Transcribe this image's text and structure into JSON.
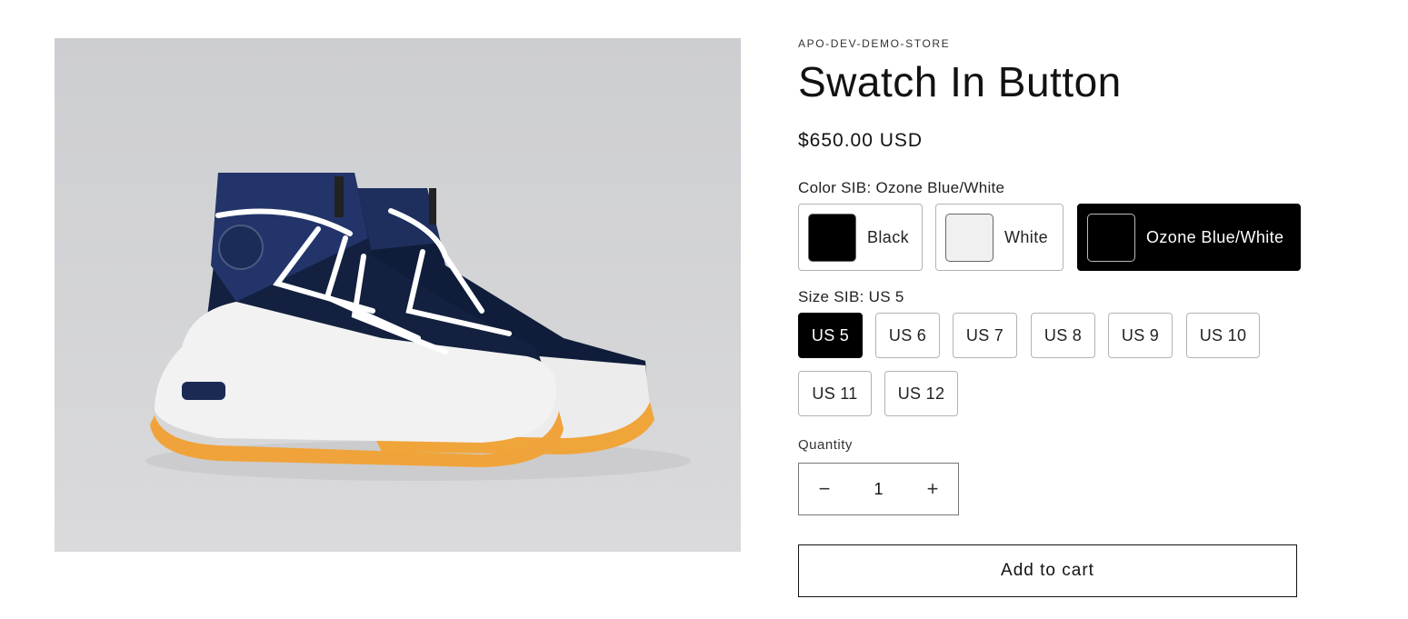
{
  "product": {
    "vendor": "APO-DEV-DEMO-STORE",
    "title": "Swatch In Button",
    "price": "$650.00 USD",
    "image_alt": "navy high-top sneaker with white laces and orange outsole"
  },
  "color_option": {
    "label": "Color SIB: Ozone Blue/White",
    "swatches": [
      {
        "name": "Black",
        "color": "#000000",
        "selected": false
      },
      {
        "name": "White",
        "color": "#f0f0f0",
        "selected": false
      },
      {
        "name": "Ozone Blue/White",
        "color": "#000000",
        "selected": true
      }
    ]
  },
  "size_option": {
    "label": "Size SIB: US 5",
    "values": [
      "US 5",
      "US 6",
      "US 7",
      "US 8",
      "US 9",
      "US 10",
      "US 11",
      "US 12"
    ],
    "selected": "US 5"
  },
  "quantity": {
    "label": "Quantity",
    "value": "1",
    "minus": "−",
    "plus": "+"
  },
  "actions": {
    "add_to_cart": "Add to cart"
  }
}
